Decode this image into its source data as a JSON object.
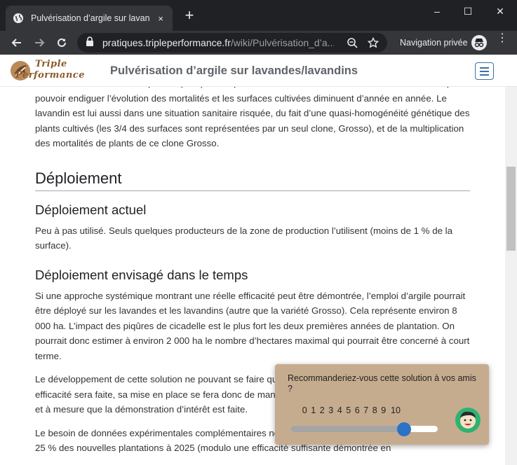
{
  "browser": {
    "tab_title": "Pulvérisation d’argile sur lavande",
    "tab_close": "×",
    "new_tab": "+",
    "url_host": "pratiques.tripleperformance.fr",
    "url_path": "/wiki/Pulvérisation_d’a...",
    "private_label": "Navigation privée",
    "window_minimize": "–",
    "window_maximize": "☐",
    "window_close": "✕",
    "menu": "⋮"
  },
  "site": {
    "logo_line1": "Triple",
    "logo_line2": "Performance",
    "page_title": "Pulvérisation d’argile sur lavandes/lavandins"
  },
  "content": {
    "intro_partial": "La situation actuelle est de plus en plus préoccupante : les variétés de lavande créées ne semblent plus pouvoir endiguer l’évolution des mortalités et les surfaces cultivées diminuent d’année en année. Le lavandin est lui aussi dans une situation sanitaire risquée, du fait d’une quasi-homogénéité génétique des plants cultivés (les 3/4 des surfaces sont représentées par un seul clone, Grosso), et de la multiplication des mortalités de plants de ce clone Grosso.",
    "h2_deploiement": "Déploiement",
    "h3_actuel": "Déploiement actuel",
    "p_actuel": "Peu à pas utilisé. Seuls quelques producteurs de la zone de production l’utilisent (moins de 1 % de la surface).",
    "h3_envisage": "Déploiement envisagé dans le temps",
    "p_envisage1": "Si une approche systémique montrant une réelle efficacité peut être démontrée, l’emploi d’argile pourrait être déployé sur les lavandes et les lavandins (autre que la variété Grosso). Cela représente environ 8 000 ha. L’impact des piqûres de cicadelle est le plus fort les deux premières années de plantation. On pourrait donc estimer à environ 2 000 ha le nombre d’hectares maximal qui pourrait être concerné à court terme.",
    "p_envisage2": "Le développement de cette solution ne pouvant se faire qu’une fois que la démonstration de son efficacité sera faite, sa mise en place se fera donc de manière progressive, sur plusieurs années, au fur et à mesure que la démonstration d’intérêt est faite.",
    "p_envisage3": "Le besoin de données expérimentales complémentaires ne permet pas un déploiement à court terme : 25 % des nouvelles plantations à 2025 (modulo une efficacité suffisante démontrée en"
  },
  "feedback": {
    "question": "Recommanderiez-vous cette solution à vos amis ?",
    "scale": [
      "0",
      "1",
      "2",
      "3",
      "4",
      "5",
      "6",
      "7",
      "8",
      "9",
      "10"
    ],
    "slider_value": 8,
    "slider_max": 10
  },
  "colors": {
    "popup_bg": "#c6ac8f",
    "slider_thumb": "#2a73c5",
    "smiley": "#2db36f",
    "logo": "#8a5a2b"
  }
}
